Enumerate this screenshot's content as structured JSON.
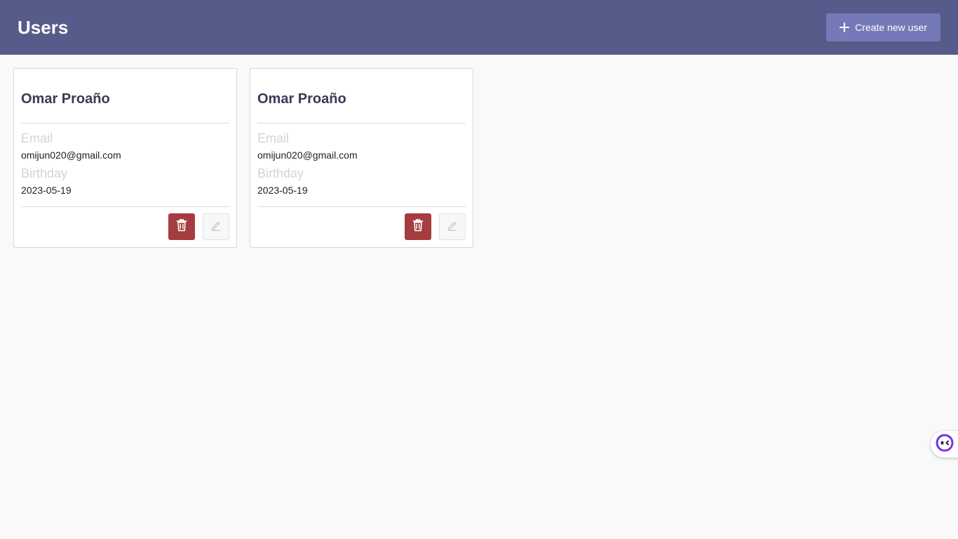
{
  "header": {
    "title": "Users",
    "create_button_label": "Create new user"
  },
  "labels": {
    "email": "Email",
    "birthday": "Birthday"
  },
  "users": [
    {
      "name": "Omar Proaño",
      "email": "omijun020@gmail.com",
      "birthday": "2023-05-19"
    },
    {
      "name": "Omar Proaño",
      "email": "omijun020@gmail.com",
      "birthday": "2023-05-19"
    }
  ],
  "icons": {
    "create": "plus-icon",
    "delete": "trash-icon",
    "edit": "pencil-icon",
    "widget": "assistant-face-icon"
  },
  "colors": {
    "header_bg": "#575b8a",
    "create_button_bg": "#7479b7",
    "delete_button_bg": "#a53c3f",
    "name_text": "#383a55"
  }
}
